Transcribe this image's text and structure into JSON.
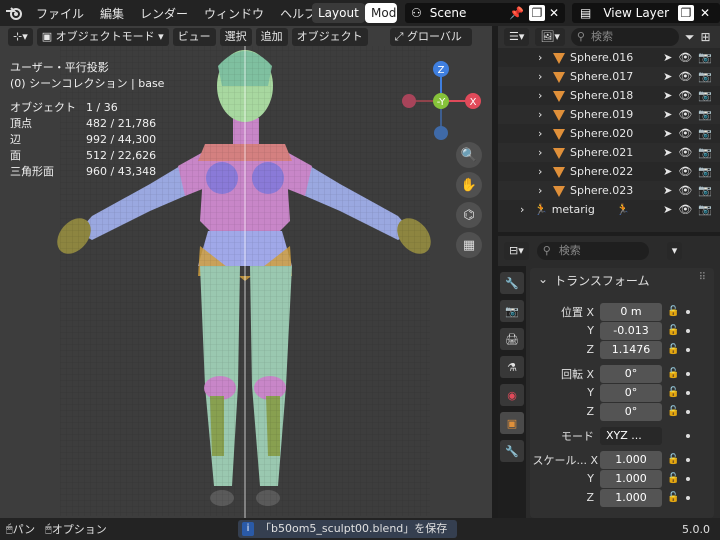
{
  "menubar": {
    "items": [
      "ファイル",
      "編集",
      "レンダー",
      "ウィンドウ",
      "ヘルプ"
    ]
  },
  "workspaces": {
    "active": "Layout",
    "next": "Mod"
  },
  "scene": {
    "name": "Scene"
  },
  "view_layer": {
    "name": "View Layer"
  },
  "viewport_header": {
    "mode": "オブジェクトモード",
    "view": "ビュー",
    "select": "選択",
    "add": "追加",
    "object": "オブジェクト",
    "transform": "グローバル"
  },
  "viewport_info": {
    "line1": "ユーザー・平行投影",
    "line2": "(0) シーンコレクション | base"
  },
  "stats": [
    {
      "label": "オブジェクト",
      "value": "1 / 36"
    },
    {
      "label": "頂点",
      "value": "482 / 21,786"
    },
    {
      "label": "辺",
      "value": "992 / 44,300"
    },
    {
      "label": "面",
      "value": "512 / 22,626"
    },
    {
      "label": "三角形面",
      "value": "960 / 43,348"
    }
  ],
  "gizmo": {
    "z": "Z",
    "y": "-Y",
    "x": "X"
  },
  "outliner": {
    "search_placeholder": "検索",
    "items": [
      "Sphere.016",
      "Sphere.017",
      "Sphere.018",
      "Sphere.019",
      "Sphere.020",
      "Sphere.021",
      "Sphere.022",
      "Sphere.023"
    ],
    "armature": "metarig"
  },
  "properties": {
    "search_placeholder": "検索",
    "panel_title": "トランスフォーム",
    "location": {
      "label": "位置",
      "x": "0 m",
      "y": "-0.013",
      "z": "1.1476"
    },
    "rotation": {
      "label": "回転",
      "x": "0°",
      "y": "0°",
      "z": "0°"
    },
    "mode": {
      "label": "モード",
      "value": "XYZ ..."
    },
    "scale": {
      "label": "スケール...",
      "x": "1.000",
      "y": "1.000",
      "z": "1.000"
    },
    "axis": {
      "x": "X",
      "y": "Y",
      "z": "Z"
    }
  },
  "statusbar": {
    "pan": "パン",
    "options": "オプション",
    "message": "「b50om5_sculpt00.blend」を保存",
    "version": "5.0.0"
  }
}
